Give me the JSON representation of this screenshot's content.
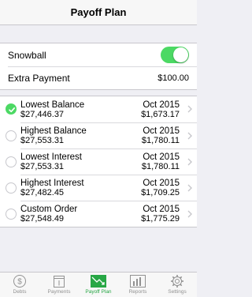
{
  "nav": {
    "title": "Payoff Plan"
  },
  "settings": {
    "snowball_label": "Snowball",
    "snowball_on": true,
    "extra_payment_label": "Extra Payment",
    "extra_payment_value": "$100.00"
  },
  "plans": [
    {
      "name": "Lowest Balance",
      "amount": "$27,446.37",
      "date": "Oct 2015",
      "payment": "$1,673.17",
      "selected": true
    },
    {
      "name": "Highest Balance",
      "amount": "$27,553.31",
      "date": "Oct 2015",
      "payment": "$1,780.11",
      "selected": false
    },
    {
      "name": "Lowest Interest",
      "amount": "$27,553.31",
      "date": "Oct 2015",
      "payment": "$1,780.11",
      "selected": false
    },
    {
      "name": "Highest Interest",
      "amount": "$27,482.45",
      "date": "Oct 2015",
      "payment": "$1,709.25",
      "selected": false
    },
    {
      "name": "Custom Order",
      "amount": "$27,548.49",
      "date": "Oct 2015",
      "payment": "$1,775.29",
      "selected": false
    }
  ],
  "tabs": [
    {
      "label": "Debts",
      "icon": "dollar-coin-icon",
      "active": false
    },
    {
      "label": "Payments",
      "icon": "calendar-icon",
      "active": false
    },
    {
      "label": "Payoff Plan",
      "icon": "trend-down-icon",
      "active": true
    },
    {
      "label": "Reports",
      "icon": "bar-chart-icon",
      "active": false
    },
    {
      "label": "Settings",
      "icon": "gear-icon",
      "active": false
    }
  ],
  "colors": {
    "accent_green": "#4cd964",
    "active_tab": "#27a745",
    "inactive_tab": "#929292"
  }
}
